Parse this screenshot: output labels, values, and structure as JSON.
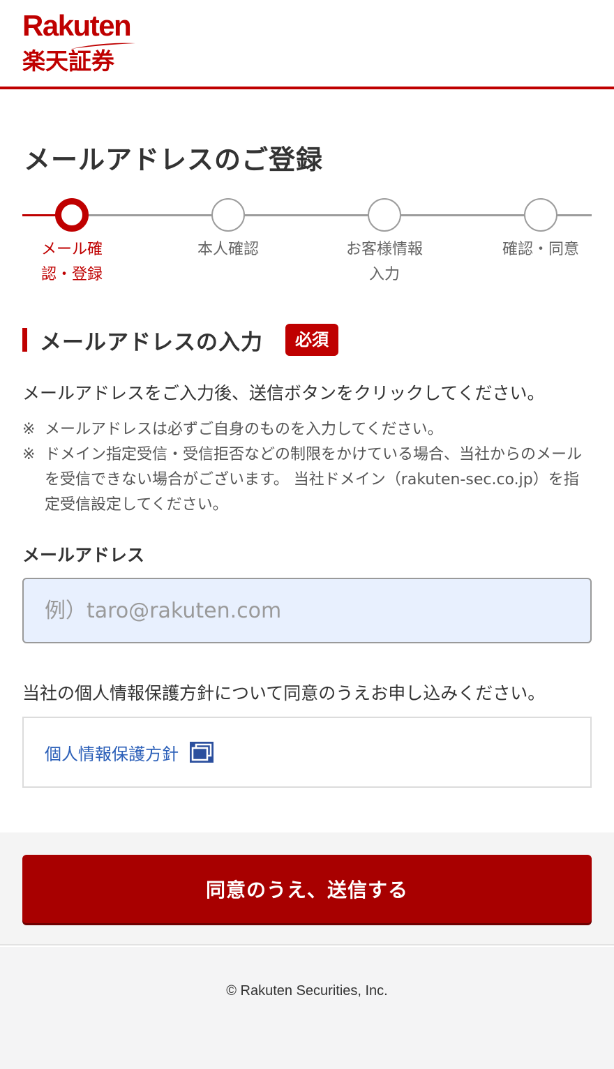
{
  "header": {
    "logo_en": "Rakuten",
    "logo_jp": "楽天証券"
  },
  "page": {
    "title": "メールアドレスのご登録"
  },
  "stepper": {
    "steps": [
      {
        "label_line1": "メール確",
        "label_line2": "認・登録",
        "active": true
      },
      {
        "label_line1": "本人確認",
        "label_line2": "",
        "active": false
      },
      {
        "label_line1": "お客様情報",
        "label_line2": "入力",
        "active": false
      },
      {
        "label_line1": "確認・同意",
        "label_line2": "",
        "active": false
      }
    ],
    "current_step": 1
  },
  "section": {
    "title": "メールアドレスの入力",
    "required_badge": "必須"
  },
  "instruction": "メールアドレスをご入力後、送信ボタンをクリックしてください。",
  "notes": [
    {
      "mark": "※",
      "text": "メールアドレスは必ずご自身のものを入力してください。"
    },
    {
      "mark": "※",
      "text": "ドメイン指定受信・受信拒否などの制限をかけている場合、当社からのメールを受信できない場合がございます。 当社ドメイン（rakuten-sec.co.jp）を指定受信設定してください。"
    }
  ],
  "email": {
    "label": "メールアドレス",
    "value": "",
    "placeholder": "例）taro@rakuten.com"
  },
  "privacy": {
    "text": "当社の個人情報保護方針について同意のうえお申し込みください。",
    "link_label": "個人情報保護方針",
    "link_icon": "external-window-icon"
  },
  "submit": {
    "label": "同意のうえ、送信する"
  },
  "footer": {
    "copyright": "© Rakuten Securities, Inc."
  },
  "colors": {
    "brand": "#bf0000",
    "button": "#a80000",
    "link": "#2b5fb8",
    "input_bg": "#e8f0fe"
  }
}
